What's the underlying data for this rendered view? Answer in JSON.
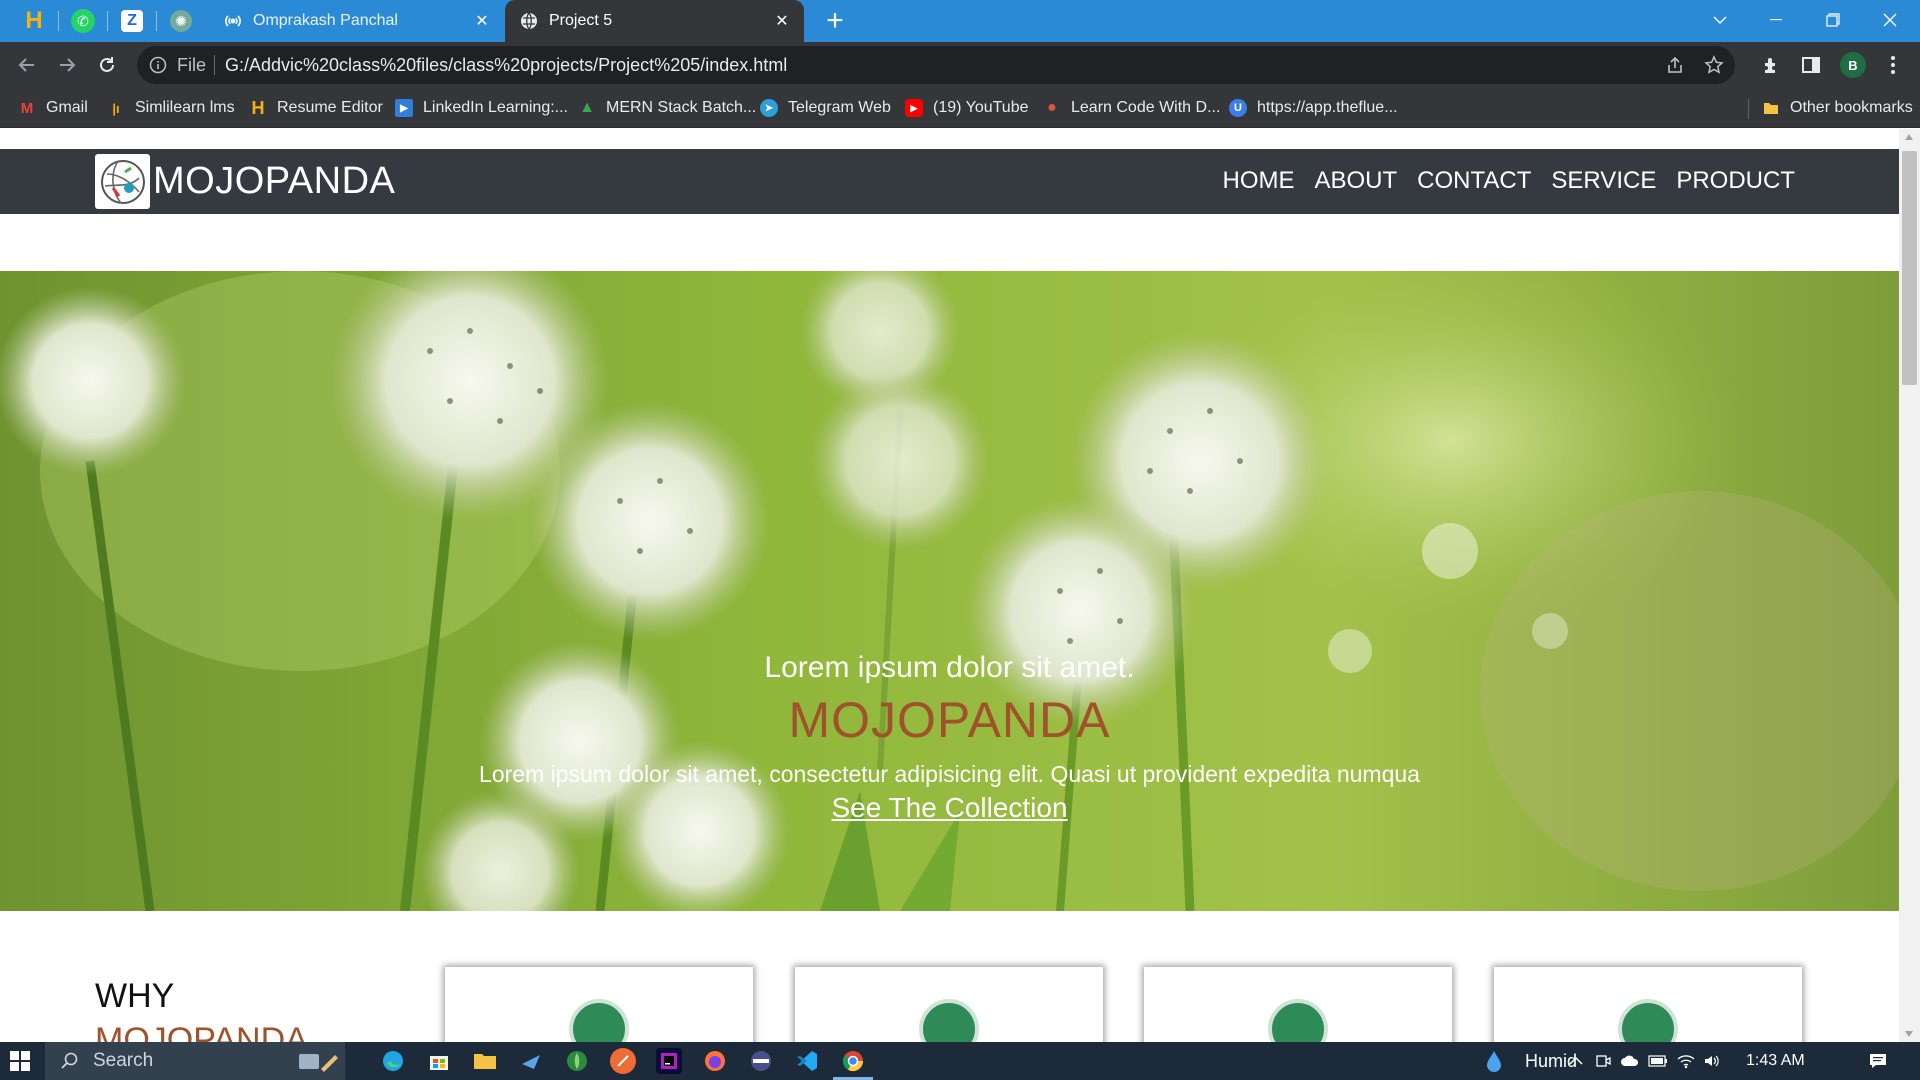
{
  "browser": {
    "pinned_tabs": [
      {
        "name": "h-icon",
        "glyph": "H",
        "color": "#f5b20e"
      },
      {
        "name": "whatsapp-icon",
        "glyph": "✆",
        "color": "#25d366"
      },
      {
        "name": "zoho-icon",
        "glyph": "Z",
        "color": "#2266e3"
      },
      {
        "name": "openai-icon",
        "glyph": "✺",
        "color": "#74aa9c"
      }
    ],
    "tabs": [
      {
        "title": "Omprakash Panchal",
        "active": false
      },
      {
        "title": "Project 5",
        "active": true
      }
    ],
    "close_glyph": "✕",
    "new_tab_glyph": "+",
    "address": {
      "scheme_label": "File",
      "url": "G:/Addvic%20class%20files/class%20projects/Project%205/index.html"
    },
    "profile_initial": "B",
    "bookmarks": [
      {
        "label": "Gmail",
        "icon": "gmail-icon",
        "glyph": "M",
        "color": "#ea4335"
      },
      {
        "label": "Simlilearn lms",
        "icon": "simplilearn-icon",
        "glyph": "|ı",
        "color": "#f5b20e"
      },
      {
        "label": "Resume Editor",
        "icon": "h-icon",
        "glyph": "H",
        "color": "#f5b20e"
      },
      {
        "label": "LinkedIn Learning:...",
        "icon": "linkedin-learning-icon",
        "glyph": "▶",
        "color": "#2f7fd8"
      },
      {
        "label": "MERN Stack Batch...",
        "icon": "drive-icon",
        "glyph": "▲",
        "color": "#34a853"
      },
      {
        "label": "Telegram Web",
        "icon": "telegram-icon",
        "glyph": "➤",
        "color": "#2aa1da"
      },
      {
        "label": "(19) YouTube",
        "icon": "youtube-icon",
        "glyph": "▶",
        "color": "#ff0000"
      },
      {
        "label": "Learn Code With D...",
        "icon": "learncode-icon",
        "glyph": "●",
        "color": "#e0533c"
      },
      {
        "label": "https://app.theflue...",
        "icon": "fluent-icon",
        "glyph": "U",
        "color": "#3a7ee8"
      }
    ],
    "other_bookmarks": "Other bookmarks"
  },
  "site": {
    "brand": "MOJOPANDA",
    "nav": [
      "HOME",
      "ABOUT",
      "CONTACT",
      "SERVICE",
      "PRODUCT"
    ],
    "hero": {
      "line1": "Lorem ipsum dolor sit amet.",
      "brand": "MOJOPANDA",
      "line2": "Lorem ipsum dolor sit amet, consectetur adipisicing elit. Quasi ut provident expedita numqua",
      "link": "See The Collection"
    },
    "why": {
      "line1": "WHY",
      "line2": "MOJOPANDA"
    },
    "accent_color": "#a0522d",
    "nav_bg": "#343a40"
  },
  "taskbar": {
    "search_placeholder": "Search",
    "weather": "Humid",
    "time": "1:43 AM"
  }
}
